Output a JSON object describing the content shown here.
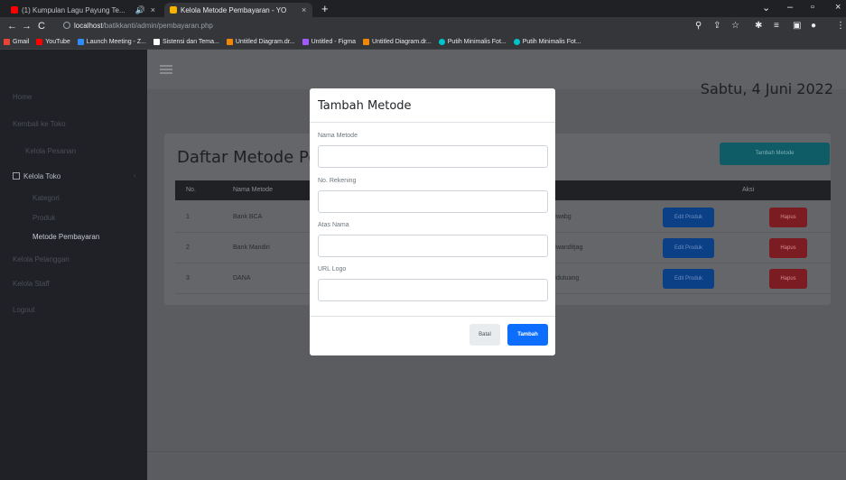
{
  "browser": {
    "tabs": [
      {
        "label": "(1) Kumpulan Lagu Payung Te...",
        "favicon_color": "#ff0000"
      },
      {
        "label": "Kelola Metode Pembayaran - YO",
        "favicon_color": "#f4b400"
      }
    ],
    "url_host": "localhost",
    "url_path": "/batikkanti/admin/pembayaran.php",
    "bookmarks": [
      {
        "label": "Gmail",
        "color": "#ea4335"
      },
      {
        "label": "YouTube",
        "color": "#ff0000"
      },
      {
        "label": "Launch Meeting - Z...",
        "color": "#2d8cff"
      },
      {
        "label": "Sistensi dan Tema...",
        "color": "#ffffff"
      },
      {
        "label": "Untitled Diagram.dr...",
        "color": "#f08705"
      },
      {
        "label": "Untitled - Figma",
        "color": "#a259ff"
      },
      {
        "label": "Untitled Diagram.dr...",
        "color": "#f08705"
      },
      {
        "label": "Putih Minimalis Fot...",
        "color": "#00c4cc"
      },
      {
        "label": "Putih Minimalis Fot...",
        "color": "#00c4cc"
      }
    ]
  },
  "sidebar": {
    "items": [
      {
        "label": "Home"
      },
      {
        "label": "Kembali ke Toko"
      },
      {
        "label": "Kelola Pesanan"
      },
      {
        "label": "Kelola Toko"
      },
      {
        "label": "Kategori"
      },
      {
        "label": "Produk"
      },
      {
        "label": "Metode Pembayaran"
      },
      {
        "label": "Kelola Pelanggan"
      },
      {
        "label": "Kelola Staff"
      },
      {
        "label": "Logout"
      }
    ]
  },
  "header": {
    "date": "Sabtu, 4 Juni 2022"
  },
  "main": {
    "title": "Daftar Metode Pembayaran",
    "add_button": "Tambah Metode",
    "columns": [
      "No.",
      "Nama Metode",
      "",
      "Aksi"
    ],
    "rows": [
      {
        "no": "1",
        "name": "Bank BCA",
        "atas_nama": "Iwabg",
        "edit": "Edit Produk",
        "delete": "Hapus"
      },
      {
        "no": "2",
        "name": "Bank Mandiri",
        "atas_nama": "Iwanditjag",
        "edit": "Edit Produk",
        "delete": "Hapus"
      },
      {
        "no": "3",
        "name": "DANA",
        "atas_nama": "Idutuang",
        "edit": "Edit Produk",
        "delete": "Hapus"
      }
    ]
  },
  "modal": {
    "title": "Tambah Metode",
    "fields": [
      {
        "label": "Nama Metode",
        "value": "",
        "placeholder": ""
      },
      {
        "label": "No. Rekening",
        "value": "",
        "placeholder": ""
      },
      {
        "label": "Atas Nama",
        "value": "",
        "placeholder": ""
      },
      {
        "label": "URL Logo",
        "value": "",
        "placeholder": ""
      }
    ],
    "cancel_label": "Batal",
    "submit_label": "Tambah"
  },
  "colors": {
    "primary": "#0d6efd",
    "teal": "#17a2b8",
    "danger": "#dc3545"
  }
}
